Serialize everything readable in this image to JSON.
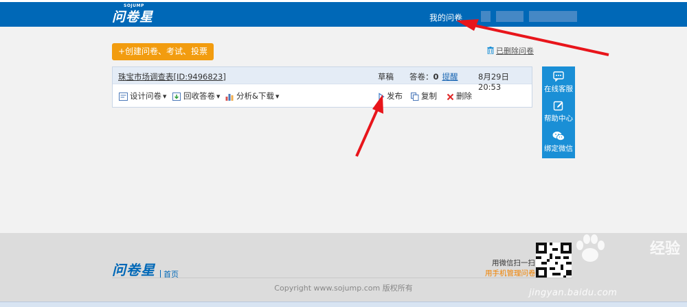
{
  "header": {
    "logo_small": "SOJUMP",
    "logo": "问卷星",
    "my_survey": "我的问卷"
  },
  "toolbar": {
    "create_label": "+创建问卷、考试、投票",
    "deleted_label": "已删除问卷"
  },
  "survey": {
    "title": "珠宝市场调查表",
    "id": "[ID:9496823]",
    "status": "草稿",
    "answers_label": "答卷：",
    "answers_count": "0",
    "remind_label": "提醒",
    "date": "8月29日 20:53",
    "actions": {
      "design": "设计问卷",
      "collect": "回收答卷",
      "analysis": "分析&下载",
      "publish": "发布",
      "copy": "复制",
      "delete": "删除"
    }
  },
  "side": {
    "service": "在线客服",
    "help": "帮助中心",
    "wechat": "绑定微信"
  },
  "footer": {
    "logo": "问卷星",
    "home": "首页",
    "wx_scan": "用微信扫一扫",
    "wx_manage": "用手机管理问卷",
    "copyright": "Copyright  www.sojump.com  版权所有"
  },
  "watermark": {
    "brand": "经验",
    "site": "jingyan.baidu.com"
  },
  "colors": {
    "header_bg": "#0068b7",
    "create_button": "#f29c0f",
    "side_panel": "#1a8fd6",
    "arrow": "#e8151b"
  }
}
